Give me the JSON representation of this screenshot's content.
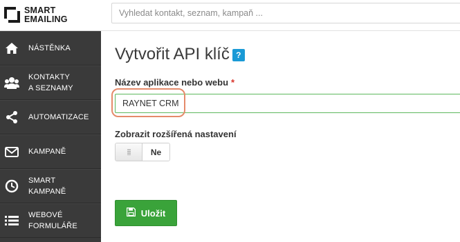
{
  "logo": {
    "line1": "SMART",
    "line2": "EMAILING"
  },
  "search": {
    "placeholder": "Vyhledat kontakt, seznam, kampaň ..."
  },
  "sidebar": {
    "items": [
      {
        "label_lines": [
          "NÁSTĚNKA"
        ],
        "icon": "home-icon"
      },
      {
        "label_lines": [
          "KONTAKTY",
          "A SEZNAMY"
        ],
        "icon": "users-icon"
      },
      {
        "label_lines": [
          "AUTOMATIZACE"
        ],
        "icon": "share-icon"
      },
      {
        "label_lines": [
          "KAMPANĚ"
        ],
        "icon": "envelope-icon"
      },
      {
        "label_lines": [
          "SMART",
          "KAMPANĚ"
        ],
        "icon": "clock-icon"
      },
      {
        "label_lines": [
          "WEBOVÉ",
          "FORMULÁŘE"
        ],
        "icon": "list-icon"
      }
    ]
  },
  "main": {
    "title": "Vytvořit API klíč",
    "help_label": "?",
    "name_label": "Název aplikace nebo webu",
    "required_mark": "*",
    "name_value": "RAYNET CRM",
    "advanced_label": "Zobrazit rozšířená nastavení",
    "toggle_state": "Ne",
    "save_label": "Uložit"
  },
  "colors": {
    "sidebar_bg": "#3a3a3a",
    "accent_green": "#3aa33a",
    "help_blue": "#1a9ad6",
    "required_red": "#d9342b",
    "highlight": "#e58a6a"
  }
}
